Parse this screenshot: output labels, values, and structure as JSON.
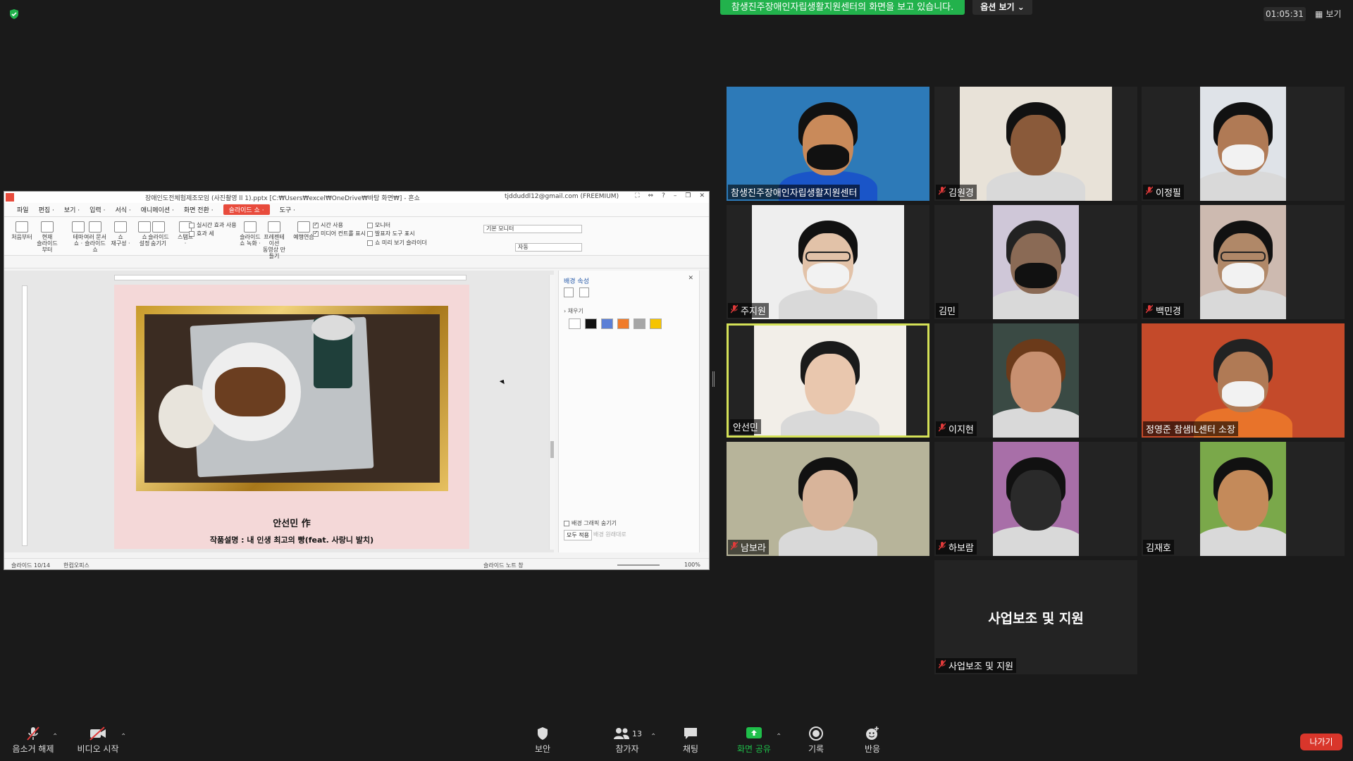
{
  "top": {
    "share_banner": "참생진주장애인자립생활지원센터의 화면을 보고 있습니다.",
    "view_options": "옵션 보기 ⌄",
    "timer": "01:05:31",
    "view_button": "보기"
  },
  "shared_window": {
    "title": "장애인도전체험제조모임 (사진촬영 ll 1).pptx [C:₩Users₩excel₩OneDrive₩바탕 화면₩] - 흔쇼",
    "account": "tjdduddl12@gmail.com (FREEMIUM)",
    "menus": [
      "파일",
      "편집 ·",
      "보기 ·",
      "입력 ·",
      "서식 ·",
      "애니메이션 ·",
      "화면 전환 ·",
      "슬라이드 쇼 ·",
      "도구 ·"
    ],
    "active_menu_index": 7,
    "ribbon_buttons": [
      {
        "label": "처음부터"
      },
      {
        "label": "현재\n슬라이드부터"
      },
      {
        "label": "테마\n쇼 ·"
      },
      {
        "label": "여러 문서\n슬라이드 쇼"
      },
      {
        "label": "쇼\n재구성 ·"
      },
      {
        "label": "쇼\n설정"
      },
      {
        "label": "슬라이드\n숨기기"
      },
      {
        "label": "스탬프\n·"
      },
      {
        "label": "슬라이드\n쇼 녹화 ·"
      },
      {
        "label": "프레젠테이션\n동영상 만들기"
      },
      {
        "label": "예행연습"
      }
    ],
    "ribbon_checks": [
      {
        "label": "실시간 효과 사용",
        "checked": false
      },
      {
        "label": "효과 세",
        "checked": false
      },
      {
        "label": "시간 사용",
        "checked": true
      },
      {
        "label": "미디어 컨트롤 표시",
        "checked": true
      },
      {
        "label": "모니터",
        "checked": false
      },
      {
        "label": "발표자 도구 표시",
        "checked": false
      },
      {
        "label": "쇼 미리 보기 슬라이더",
        "checked": false
      }
    ],
    "monitor_select": "기본 모니터",
    "preview_select": "자동",
    "slide": {
      "title": "안선민 作",
      "description": "작품설명 : 내 인생 최고의 빵(feat. 사랑니 발치)"
    },
    "panel": {
      "title": "배경 속성",
      "fill_header": "› 채우기",
      "swatch_colors": [
        "#ffffff",
        "#111111",
        "#5b7fd6",
        "#f07b2a",
        "#a6a6a6",
        "#f5c400"
      ],
      "hide_bg_graphics": "배경 그래픽 숨기기",
      "apply_all": "모두 적용",
      "reset": "배경 원래대로"
    },
    "status": {
      "slide_no": "슬라이드 10/14",
      "theme": "한컴오피스",
      "note": "슬라이드 노트 창",
      "zoom": "100%"
    }
  },
  "participants": [
    {
      "name": "참생진주장애인자립생활지원센터",
      "muted": false
    },
    {
      "name": "김원경",
      "muted": true
    },
    {
      "name": "이정필",
      "muted": true
    },
    {
      "name": "주지원",
      "muted": true
    },
    {
      "name": "김민",
      "muted": false
    },
    {
      "name": "백민경",
      "muted": true
    },
    {
      "name": "안선민",
      "muted": false,
      "active": true
    },
    {
      "name": "이지현",
      "muted": true
    },
    {
      "name": "정영준 참샘IL센터 소장",
      "muted": false
    },
    {
      "name": "남보라",
      "muted": true
    },
    {
      "name": "하보람",
      "muted": true
    },
    {
      "name": "김재호",
      "muted": false
    },
    {
      "name": "사업보조 및 지원",
      "muted": true,
      "no_video": true
    }
  ],
  "toolbar": {
    "mute": "음소거 해제",
    "video": "비디오 시작",
    "security": "보안",
    "participants": "참가자",
    "participant_count": "13",
    "chat": "채팅",
    "share": "화면 공유",
    "record": "기록",
    "reactions": "반응",
    "leave": "나가기"
  },
  "colors": {
    "banner_green": "#22b24c",
    "active_border": "#d4e157",
    "leave_red": "#d9362b",
    "share_green": "#1fbf4a",
    "menu_active": "#e84b3c"
  }
}
